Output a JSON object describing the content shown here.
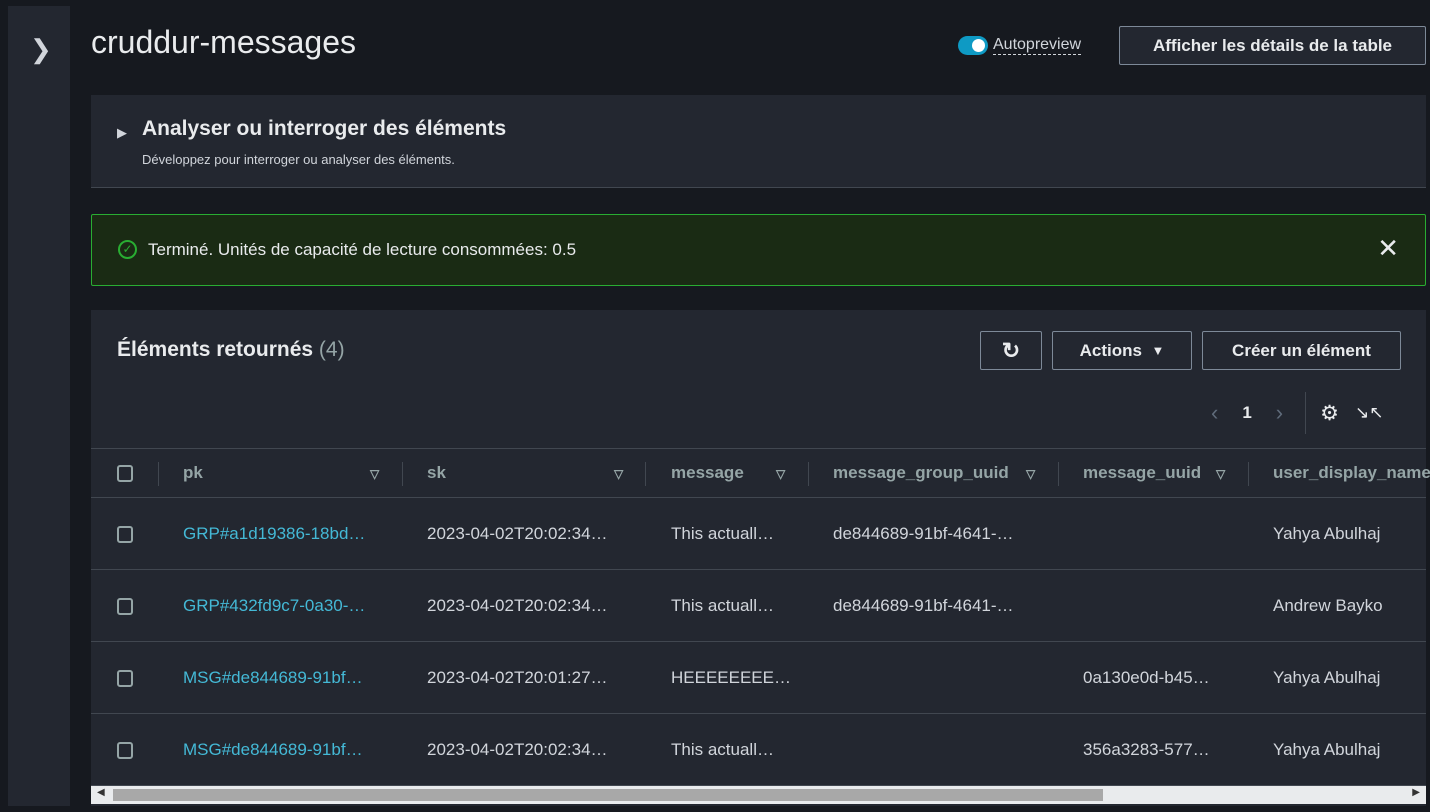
{
  "sidebar": {
    "toggle_icon": "chevron-right-icon"
  },
  "header": {
    "title": "cruddur-messages",
    "autopreview_label": "Autopreview",
    "autopreview_on": true,
    "details_button": "Afficher les détails de la table"
  },
  "query": {
    "title": "Analyser ou interroger des éléments",
    "subtitle": "Développez pour interroger ou analyser des éléments."
  },
  "alert": {
    "text": "Terminé. Unités de capacité de lecture consommées: 0.5"
  },
  "items": {
    "title": "Éléments retournés",
    "count": "(4)",
    "actions_label": "Actions",
    "create_label": "Créer un élément",
    "page": "1",
    "columns": [
      "pk",
      "sk",
      "message",
      "message_group_uuid",
      "message_uuid",
      "user_display_name"
    ],
    "rows": [
      [
        "GRP#a1d19386-18bd…",
        "2023-04-02T20:02:34…",
        "This actuall…",
        "de844689-91bf-4641-…",
        "",
        "Yahya Abulhaj"
      ],
      [
        "GRP#432fd9c7-0a30-…",
        "2023-04-02T20:02:34…",
        "This actuall…",
        "de844689-91bf-4641-…",
        "",
        "Andrew Bayko"
      ],
      [
        "MSG#de844689-91bf…",
        "2023-04-02T20:01:27…",
        "HEEEEEEEE…",
        "",
        "0a130e0d-b45…",
        "Yahya Abulhaj"
      ],
      [
        "MSG#de844689-91bf…",
        "2023-04-02T20:02:34…",
        "This actuall…",
        "",
        "356a3283-577…",
        "Yahya Abulhaj"
      ]
    ]
  },
  "colors": {
    "accent": "#0e9ac4",
    "link": "#44b9d6",
    "success": "#29ad32"
  }
}
